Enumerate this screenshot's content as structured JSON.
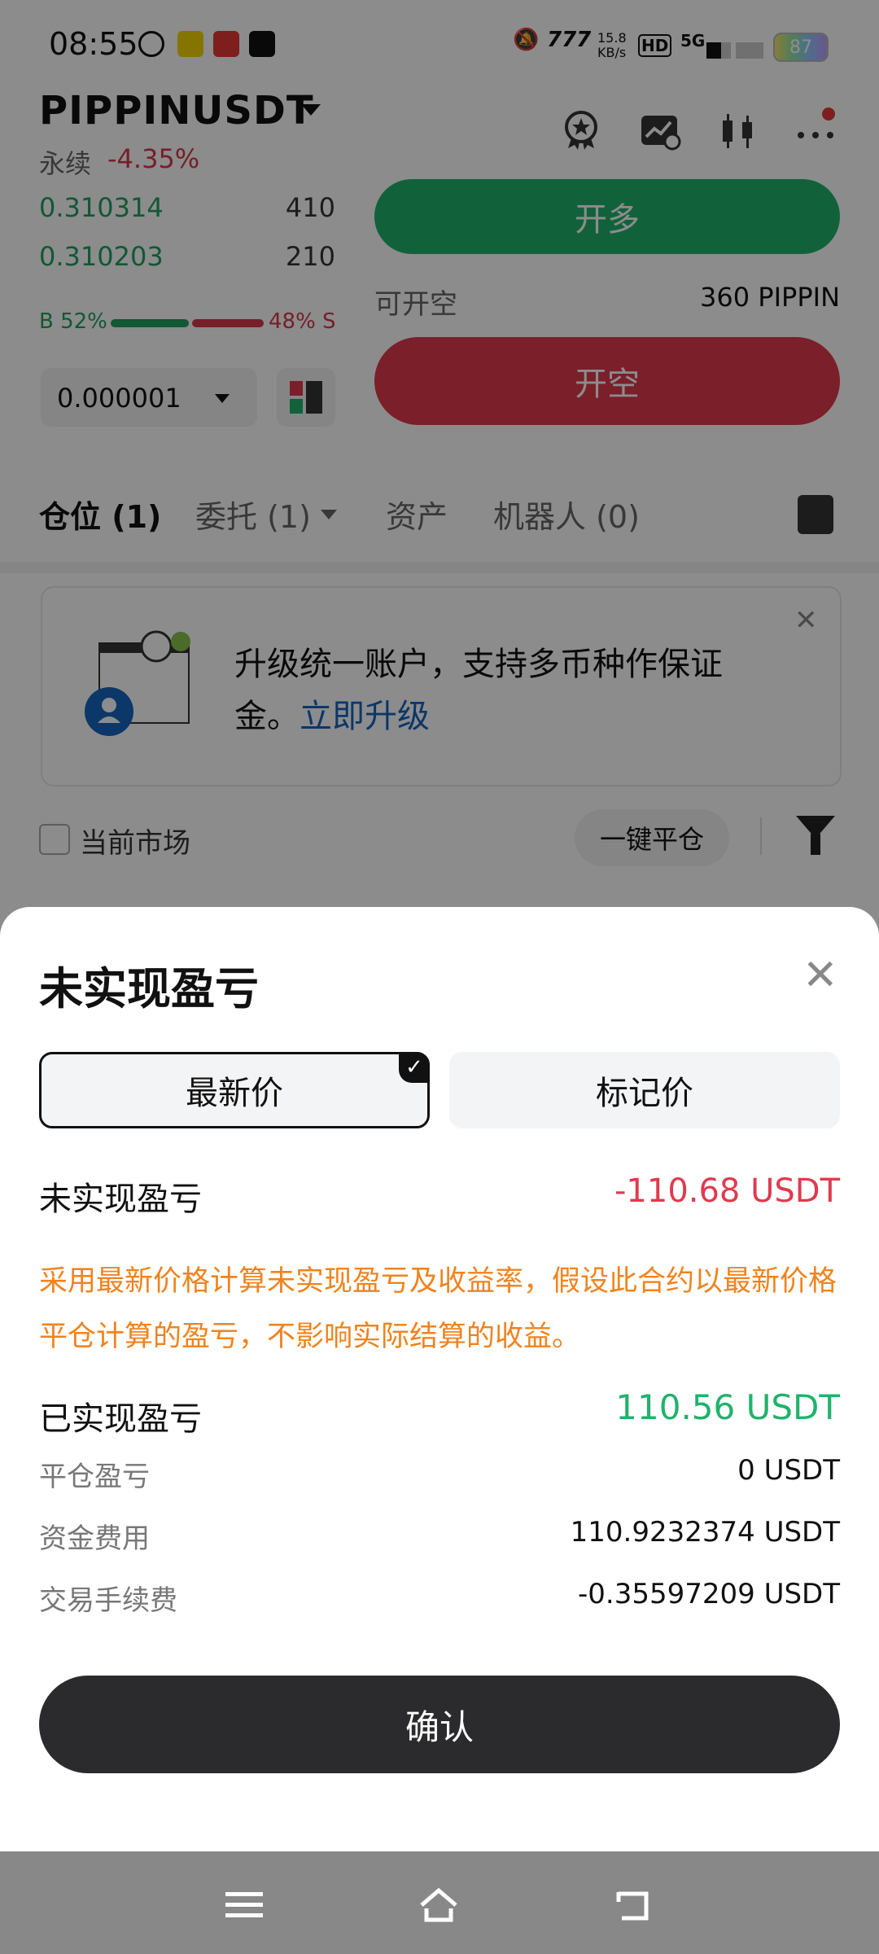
{
  "status_bar": {
    "time": "08:55",
    "net_speed": "15.8\nKB/s",
    "hd_label": "HD",
    "network": "5G",
    "battery": "87"
  },
  "header": {
    "pair": "PIPPINUSDT",
    "contract_type": "永续",
    "change": "-4.35%"
  },
  "orderbook": {
    "rows": [
      {
        "price": "0.310314",
        "qty": "410"
      },
      {
        "price": "0.310203",
        "qty": "210"
      }
    ],
    "buy_ratio": "B 52%",
    "sell_ratio": "48% S",
    "buy_ratio_value": 0.52,
    "precision": "0.000001"
  },
  "trade": {
    "long_label": "开多",
    "avail_short_label": "可开空",
    "avail_short_value": "360 PIPPIN",
    "short_label": "开空"
  },
  "tabs": [
    {
      "label": "仓位 (1)"
    },
    {
      "label": "委托 (1)"
    },
    {
      "label": "资产"
    },
    {
      "label": "机器人 (0)"
    }
  ],
  "banner": {
    "text": "升级统一账户，支持多币种作保证金。",
    "link": "立即升级"
  },
  "filters": {
    "current_market": "当前市场",
    "close_all": "一键平仓"
  },
  "sheet": {
    "title": "未实现盈亏",
    "seg_latest": "最新价",
    "seg_mark": "标记价",
    "unrealized_label": "未实现盈亏",
    "unrealized_value": "-110.68 USDT",
    "note": "采用最新价格计算未实现盈亏及收益率，假设此合约以最新价格平仓计算的盈亏，不影响实际结算的收益。",
    "realized_label": "已实现盈亏",
    "realized_value": "110.56 USDT",
    "details": [
      {
        "label": "平仓盈亏",
        "value": "0 USDT"
      },
      {
        "label": "资金费用",
        "value": "110.9232374 USDT"
      },
      {
        "label": "交易手续费",
        "value": "-0.35597209 USDT"
      }
    ],
    "confirm": "确认"
  },
  "colors": {
    "green": "#20b26b",
    "red": "#e03a4e",
    "orange_note": "#f0831e",
    "link_blue": "#1565c0"
  }
}
